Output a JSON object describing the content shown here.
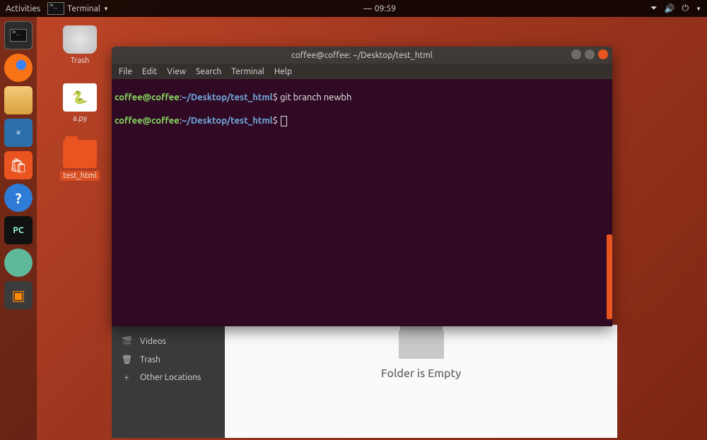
{
  "topbar": {
    "activities": "Activities",
    "app_indicator": "Terminal",
    "clock": "09:59"
  },
  "desktop_icons": {
    "trash": "Trash",
    "apy": "a.py",
    "folder": "test_html"
  },
  "terminal": {
    "title": "coffee@coffee: ~/Desktop/test_html",
    "menu": {
      "file": "File",
      "edit": "Edit",
      "view": "View",
      "search": "Search",
      "terminal": "Terminal",
      "help": "Help"
    },
    "lines": [
      {
        "user": "coffee@coffee",
        "colon": ":",
        "path": "~/Desktop/test_html",
        "dollar": "$ ",
        "cmd": "git branch newbh"
      },
      {
        "user": "coffee@coffee",
        "colon": ":",
        "path": "~/Desktop/test_html",
        "dollar": "$ ",
        "cmd": ""
      }
    ]
  },
  "files": {
    "sidebar": {
      "videos": "Videos",
      "trash": "Trash",
      "other": "Other Locations"
    },
    "empty_text": "Folder is Empty"
  }
}
